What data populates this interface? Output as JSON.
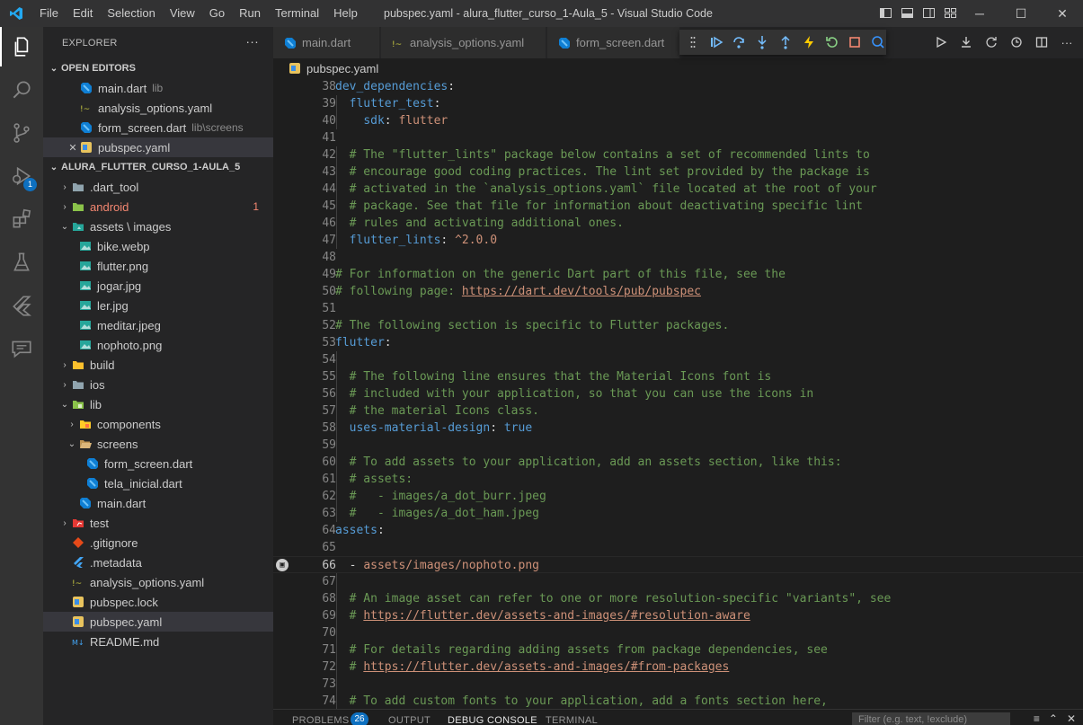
{
  "titlebar": {
    "window_title": "pubspec.yaml - alura_flutter_curso_1-Aula_5 - Visual Studio Code",
    "menu": [
      "File",
      "Edit",
      "Selection",
      "View",
      "Go",
      "Run",
      "Terminal",
      "Help"
    ],
    "layout_icons": [
      "toggle-sidebar-icon",
      "toggle-panel-icon",
      "toggle-secondary-sidebar-icon",
      "customize-layout-icon"
    ],
    "window_controls": {
      "minimize": "─",
      "maximize": "☐",
      "close": "✕"
    }
  },
  "activitybar": {
    "items": [
      "explorer-icon",
      "search-icon",
      "source-control-icon",
      "run-debug-icon",
      "extensions-icon",
      "testing-icon",
      "flutter-icon",
      "comments-icon"
    ],
    "run_badge": "1"
  },
  "explorer": {
    "title": "EXPLORER",
    "more": "···",
    "open_editors": {
      "title": "OPEN EDITORS",
      "items": [
        {
          "name": "main.dart",
          "desc": "lib",
          "icon": "dart"
        },
        {
          "name": "analysis_options.yaml",
          "desc": "",
          "icon": "yaml"
        },
        {
          "name": "form_screen.dart",
          "desc": "lib\\screens",
          "icon": "dart"
        },
        {
          "name": "pubspec.yaml",
          "desc": "",
          "icon": "pubspec",
          "close": "✕"
        }
      ]
    },
    "project": {
      "title": "ALURA_FLUTTER_CURSO_1-AULA_5",
      "items": [
        {
          "name": ".dart_tool",
          "chev": "›",
          "icon": "folder",
          "indent": 0
        },
        {
          "name": "android",
          "chev": "›",
          "icon": "folder-android",
          "indent": 0,
          "count": "1"
        },
        {
          "name": "assets \\ images",
          "chev": "⌄",
          "icon": "folder-images",
          "indent": 0
        },
        {
          "name": "bike.webp",
          "chev": "",
          "icon": "image",
          "indent": 1
        },
        {
          "name": "flutter.png",
          "chev": "",
          "icon": "image",
          "indent": 1
        },
        {
          "name": "jogar.jpg",
          "chev": "",
          "icon": "image",
          "indent": 1
        },
        {
          "name": "ler.jpg",
          "chev": "",
          "icon": "image",
          "indent": 1
        },
        {
          "name": "meditar.jpeg",
          "chev": "",
          "icon": "image",
          "indent": 1
        },
        {
          "name": "nophoto.png",
          "chev": "",
          "icon": "image",
          "indent": 1
        },
        {
          "name": "build",
          "chev": "›",
          "icon": "folder-build",
          "indent": 0
        },
        {
          "name": "ios",
          "chev": "›",
          "icon": "folder",
          "indent": 0
        },
        {
          "name": "lib",
          "chev": "⌄",
          "icon": "folder-lib",
          "indent": 0
        },
        {
          "name": "components",
          "chev": "›",
          "icon": "folder-components",
          "indent": 1
        },
        {
          "name": "screens",
          "chev": "⌄",
          "icon": "folder-open",
          "indent": 1
        },
        {
          "name": "form_screen.dart",
          "chev": "",
          "icon": "dart",
          "indent": 2
        },
        {
          "name": "tela_inicial.dart",
          "chev": "",
          "icon": "dart",
          "indent": 2
        },
        {
          "name": "main.dart",
          "chev": "",
          "icon": "dart",
          "indent": 1
        },
        {
          "name": "test",
          "chev": "›",
          "icon": "folder-test",
          "indent": 0
        },
        {
          "name": ".gitignore",
          "chev": "",
          "icon": "git",
          "indent": 0
        },
        {
          "name": ".metadata",
          "chev": "",
          "icon": "flutter",
          "indent": 0
        },
        {
          "name": "analysis_options.yaml",
          "chev": "",
          "icon": "yaml",
          "indent": 0
        },
        {
          "name": "pubspec.lock",
          "chev": "",
          "icon": "pubspec",
          "indent": 0
        },
        {
          "name": "pubspec.yaml",
          "chev": "",
          "icon": "pubspec",
          "indent": 0,
          "selected": true
        },
        {
          "name": "README.md",
          "chev": "",
          "icon": "readme",
          "indent": 0
        }
      ]
    }
  },
  "editor": {
    "tabs": [
      {
        "name": "main.dart",
        "icon": "dart"
      },
      {
        "name": "analysis_options.yaml",
        "icon": "yaml"
      },
      {
        "name": "form_screen.dart",
        "icon": "dart"
      }
    ],
    "debug_toolbar": [
      "drag-handle-icon",
      "continue-icon",
      "step-over-icon",
      "step-into-icon",
      "step-out-icon",
      "hot-reload-icon",
      "restart-icon",
      "stop-icon",
      "devtools-icon"
    ],
    "actions": [
      "run-icon",
      "download-icon",
      "refresh-icon",
      "history-icon",
      "split-editor-icon",
      "more-actions-icon"
    ],
    "breadcrumb": "pubspec.yaml",
    "current_line": 66,
    "lines": [
      {
        "n": 38,
        "t": [
          [
            "k",
            "dev_dependencies"
          ],
          [
            "p",
            ":"
          ]
        ]
      },
      {
        "n": 39,
        "t": [
          [
            "p",
            "  "
          ],
          [
            "k",
            "flutter_test"
          ],
          [
            "p",
            ":"
          ]
        ]
      },
      {
        "n": 40,
        "t": [
          [
            "p",
            "    "
          ],
          [
            "k",
            "sdk"
          ],
          [
            "p",
            ": "
          ],
          [
            "v",
            "flutter"
          ]
        ]
      },
      {
        "n": 41,
        "t": []
      },
      {
        "n": 42,
        "t": [
          [
            "p",
            "  "
          ],
          [
            "c",
            "# The \"flutter_lints\" package below contains a set of recommended lints to"
          ]
        ]
      },
      {
        "n": 43,
        "t": [
          [
            "p",
            "  "
          ],
          [
            "c",
            "# encourage good coding practices. The lint set provided by the package is"
          ]
        ]
      },
      {
        "n": 44,
        "t": [
          [
            "p",
            "  "
          ],
          [
            "c",
            "# activated in the `analysis_options.yaml` file located at the root of your"
          ]
        ]
      },
      {
        "n": 45,
        "t": [
          [
            "p",
            "  "
          ],
          [
            "c",
            "# package. See that file for information about deactivating specific lint"
          ]
        ]
      },
      {
        "n": 46,
        "t": [
          [
            "p",
            "  "
          ],
          [
            "c",
            "# rules and activating additional ones."
          ]
        ]
      },
      {
        "n": 47,
        "t": [
          [
            "p",
            "  "
          ],
          [
            "k",
            "flutter_lints"
          ],
          [
            "p",
            ": "
          ],
          [
            "v",
            "^2.0.0"
          ]
        ]
      },
      {
        "n": 48,
        "t": []
      },
      {
        "n": 49,
        "t": [
          [
            "c",
            "# For information on the generic Dart part of this file, see the"
          ]
        ]
      },
      {
        "n": 50,
        "t": [
          [
            "c",
            "# following page: "
          ],
          [
            "u",
            "https://dart.dev/tools/pub/pubspec"
          ]
        ]
      },
      {
        "n": 51,
        "t": []
      },
      {
        "n": 52,
        "t": [
          [
            "c",
            "# The following section is specific to Flutter packages."
          ]
        ]
      },
      {
        "n": 53,
        "t": [
          [
            "k",
            "flutter"
          ],
          [
            "p",
            ":"
          ]
        ]
      },
      {
        "n": 54,
        "t": []
      },
      {
        "n": 55,
        "t": [
          [
            "p",
            "  "
          ],
          [
            "c",
            "# The following line ensures that the Material Icons font is"
          ]
        ]
      },
      {
        "n": 56,
        "t": [
          [
            "p",
            "  "
          ],
          [
            "c",
            "# included with your application, so that you can use the icons in"
          ]
        ]
      },
      {
        "n": 57,
        "t": [
          [
            "p",
            "  "
          ],
          [
            "c",
            "# the material Icons class."
          ]
        ]
      },
      {
        "n": 58,
        "t": [
          [
            "p",
            "  "
          ],
          [
            "k",
            "uses-material-design"
          ],
          [
            "p",
            ": "
          ],
          [
            "b",
            "true"
          ]
        ]
      },
      {
        "n": 59,
        "t": []
      },
      {
        "n": 60,
        "t": [
          [
            "p",
            "  "
          ],
          [
            "c",
            "# To add assets to your application, add an assets section, like this:"
          ]
        ]
      },
      {
        "n": 61,
        "t": [
          [
            "p",
            "  "
          ],
          [
            "c",
            "# assets:"
          ]
        ]
      },
      {
        "n": 62,
        "t": [
          [
            "p",
            "  "
          ],
          [
            "c",
            "#   - images/a_dot_burr.jpeg"
          ]
        ]
      },
      {
        "n": 63,
        "t": [
          [
            "p",
            "  "
          ],
          [
            "c",
            "#   - images/a_dot_ham.jpeg"
          ]
        ]
      },
      {
        "n": 64,
        "t": [
          [
            "k",
            "assets"
          ],
          [
            "p",
            ":"
          ]
        ]
      },
      {
        "n": 65,
        "t": []
      },
      {
        "n": 66,
        "t": [
          [
            "p",
            "  - "
          ],
          [
            "v",
            "assets/images/nophoto.png"
          ]
        ]
      },
      {
        "n": 67,
        "t": []
      },
      {
        "n": 68,
        "t": [
          [
            "p",
            "  "
          ],
          [
            "c",
            "# An image asset can refer to one or more resolution-specific \"variants\", see"
          ]
        ]
      },
      {
        "n": 69,
        "t": [
          [
            "p",
            "  "
          ],
          [
            "c",
            "# "
          ],
          [
            "u",
            "https://flutter.dev/assets-and-images/#resolution-aware"
          ]
        ]
      },
      {
        "n": 70,
        "t": []
      },
      {
        "n": 71,
        "t": [
          [
            "p",
            "  "
          ],
          [
            "c",
            "# For details regarding adding assets from package dependencies, see"
          ]
        ]
      },
      {
        "n": 72,
        "t": [
          [
            "p",
            "  "
          ],
          [
            "c",
            "# "
          ],
          [
            "u",
            "https://flutter.dev/assets-and-images/#from-packages"
          ]
        ]
      },
      {
        "n": 73,
        "t": []
      },
      {
        "n": 74,
        "t": [
          [
            "p",
            "  "
          ],
          [
            "c",
            "# To add custom fonts to your application, add a fonts section here,"
          ]
        ]
      }
    ]
  },
  "panel": {
    "tabs": [
      "PROBLEMS",
      "OUTPUT",
      "DEBUG CONSOLE",
      "TERMINAL"
    ],
    "active_tab": "DEBUG CONSOLE",
    "problems_count": "26",
    "filter_placeholder": "Filter (e.g. text, !exclude)",
    "actions": [
      "clear-icon",
      "collapse-icon",
      "close-icon"
    ]
  },
  "colors": {
    "accent": "#0e70c0",
    "keyword": "#569cd6",
    "comment": "#6a9955",
    "string": "#ce9178",
    "error": "#f48771"
  }
}
